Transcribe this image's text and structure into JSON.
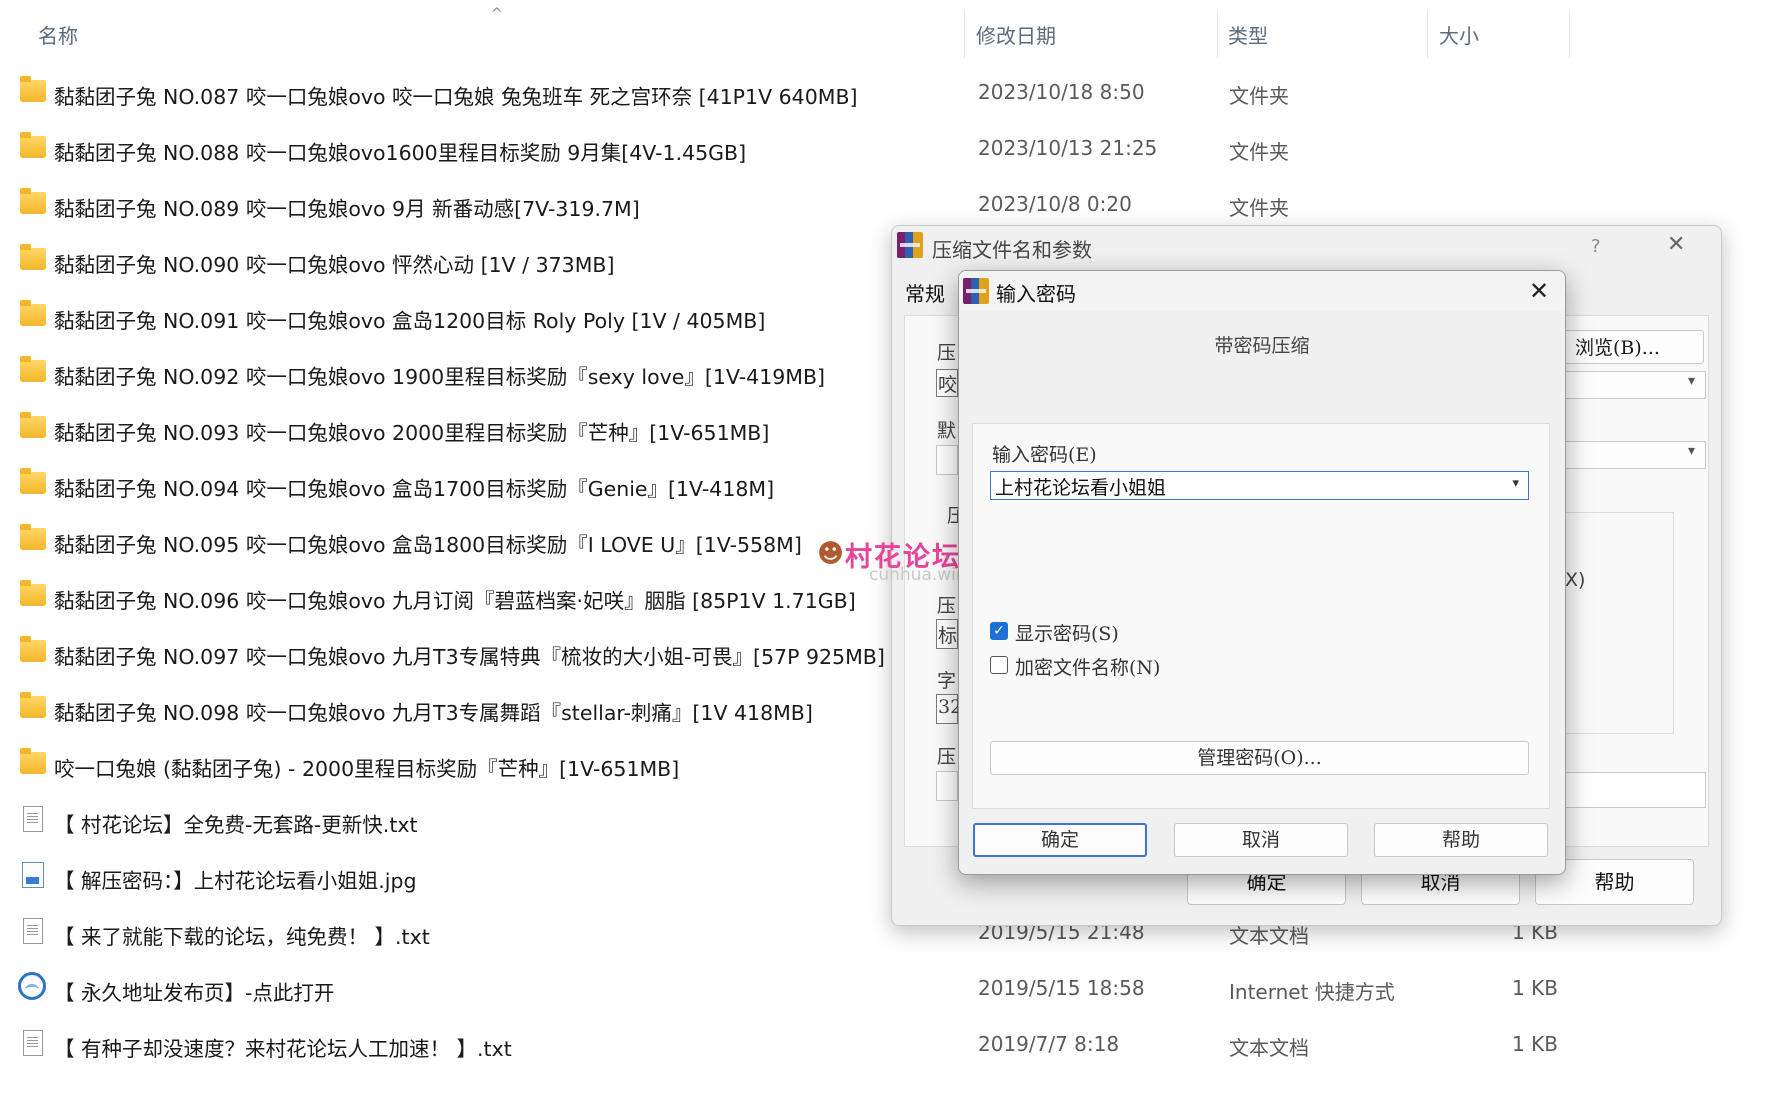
{
  "columns": {
    "name": "名称",
    "modified": "修改日期",
    "type": "类型",
    "size": "大小"
  },
  "files": [
    {
      "icon": "folder-icon",
      "name": "黏黏团子兔 NO.087 咬一口兔娘ovo 咬一口兔娘 兔兔班车 死之宫环奈 [41P1V 640MB]",
      "date": "2023/10/18 8:50",
      "type": "文件夹",
      "size": ""
    },
    {
      "icon": "folder-icon",
      "name": "黏黏团子兔 NO.088 咬一口兔娘ovo1600里程目标奖励 9月集[4V-1.45GB]",
      "date": "2023/10/13 21:25",
      "type": "文件夹",
      "size": ""
    },
    {
      "icon": "folder-icon",
      "name": "黏黏团子兔 NO.089 咬一口兔娘ovo 9月 新番动感[7V-319.7M]",
      "date": "2023/10/8 0:20",
      "type": "文件夹",
      "size": ""
    },
    {
      "icon": "folder-icon",
      "name": "黏黏团子兔 NO.090 咬一口兔娘ovo 怦然心动 [1V / 373MB]",
      "date": "",
      "type": "",
      "size": ""
    },
    {
      "icon": "folder-icon",
      "name": "黏黏团子兔 NO.091 咬一口兔娘ovo 盒岛1200目标 Roly Poly [1V / 405MB]",
      "date": "",
      "type": "",
      "size": ""
    },
    {
      "icon": "folder-icon",
      "name": "黏黏团子兔 NO.092 咬一口兔娘ovo 1900里程目标奖励『sexy love』[1V-419MB]",
      "date": "",
      "type": "",
      "size": ""
    },
    {
      "icon": "folder-icon",
      "name": "黏黏团子兔 NO.093 咬一口兔娘ovo 2000里程目标奖励『芒种』[1V-651MB]",
      "date": "",
      "type": "",
      "size": ""
    },
    {
      "icon": "folder-icon",
      "name": "黏黏团子兔 NO.094 咬一口兔娘ovo 盒岛1700目标奖励『Genie』[1V-418M]",
      "date": "",
      "type": "",
      "size": ""
    },
    {
      "icon": "folder-icon",
      "name": "黏黏团子兔 NO.095 咬一口兔娘ovo 盒岛1800目标奖励『I LOVE U』[1V-558M]",
      "date": "",
      "type": "",
      "size": ""
    },
    {
      "icon": "folder-icon",
      "name": "黏黏团子兔 NO.096 咬一口兔娘ovo 九月订阅『碧蓝档案·妃咲』胭脂 [85P1V 1.71GB]",
      "date": "",
      "type": "",
      "size": ""
    },
    {
      "icon": "folder-icon",
      "name": "黏黏团子兔 NO.097 咬一口兔娘ovo 九月T3专属特典『梳妆的大小姐-可畏』[57P 925MB]",
      "date": "",
      "type": "",
      "size": ""
    },
    {
      "icon": "folder-icon",
      "name": "黏黏团子兔 NO.098 咬一口兔娘ovo 九月T3专属舞蹈『stellar-刺痛』[1V 418MB]",
      "date": "",
      "type": "",
      "size": ""
    },
    {
      "icon": "folder-icon",
      "name": "咬一口兔娘 (黏黏团子兔) - 2000里程目标奖励『芒种』[1V-651MB]",
      "date": "",
      "type": "",
      "size": ""
    },
    {
      "icon": "text-file-icon",
      "name": "【 村花论坛】全免费-无套路-更新快.txt",
      "date": "",
      "type": "",
      "size": ""
    },
    {
      "icon": "image-file-icon",
      "name": "【 解压密码：】上村花论坛看小姐姐.jpg",
      "date": "",
      "type": "",
      "size": ""
    },
    {
      "icon": "text-file-icon",
      "name": "【 来了就能下载的论坛，纯免费！ 】.txt",
      "date": "2019/5/15 21:48",
      "type": "文本文档",
      "size": "1 KB"
    },
    {
      "icon": "internet-shortcut-icon",
      "name": "【 永久地址发布页】-点此打开",
      "date": "2019/5/15 18:58",
      "type": "Internet 快捷方式",
      "size": "1 KB"
    },
    {
      "icon": "text-file-icon",
      "name": "【 有种子却没速度？来村花论坛人工加速！ 】.txt",
      "date": "2019/7/7 8:18",
      "type": "文本文档",
      "size": "1 KB"
    }
  ],
  "watermark": {
    "title": "村花论坛",
    "subtitle": "cunhua.win"
  },
  "archive_dialog": {
    "title": "压缩文件名和参数",
    "help_mark": "?",
    "tab_general": "常规",
    "frag_1": "压",
    "frag_2": "咬",
    "frag_3": "默",
    "frag_4": "压",
    "frag_5": "压",
    "frag_6": "标",
    "frag_7": "字",
    "frag_8": "32",
    "frag_9": "压",
    "browse_label": "浏览(B)...",
    "option_fragment": "X)",
    "ok": "确定",
    "cancel": "取消",
    "help": "帮助"
  },
  "password_dialog": {
    "title": "输入密码",
    "heading": "带密码压缩",
    "password_label": "输入密码(E)",
    "password_value": "上村花论坛看小姐姐",
    "show_password": "显示密码(S)",
    "show_password_checked": true,
    "encrypt_names": "加密文件名称(N)",
    "encrypt_names_checked": false,
    "manage_button": "管理密码(O)...",
    "ok": "确定",
    "cancel": "取消",
    "help": "帮助"
  },
  "colors": {
    "accent": "#1f6fd6",
    "folder": "#f4b52a",
    "watermark": "#e8459a"
  }
}
